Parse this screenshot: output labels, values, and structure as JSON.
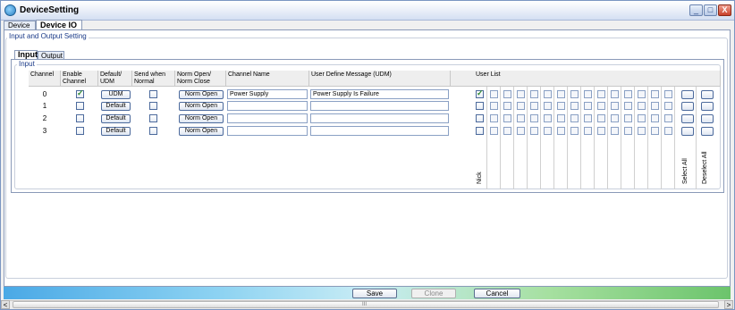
{
  "window": {
    "title": "DeviceSetting",
    "minimize": "_",
    "maximize": "□",
    "close": "X"
  },
  "outer_tabs": [
    {
      "label": "Device Info"
    },
    {
      "label": "Device IO"
    }
  ],
  "group_title": "Input and Output Setting",
  "inner_tabs": [
    {
      "label": "Input"
    },
    {
      "label": "Output"
    }
  ],
  "input_group_title": "Input",
  "columns": {
    "channel": "Channel",
    "enable": "Enable Channel",
    "default_udm": "Default/ UDM",
    "send_normal": "Send when Normal",
    "norm_mode": "Norm Open/ Norm Close",
    "channel_name": "Channel Name",
    "udm": "User Define Message (UDM)",
    "user_list": "User List"
  },
  "rows": [
    {
      "channel": "0",
      "enabled": true,
      "mode_btn": "UDM",
      "send_normal": false,
      "norm_btn": "Norm Open",
      "name": "Power Supply",
      "udm": "Power Supply Is Failure",
      "user_first": true
    },
    {
      "channel": "1",
      "enabled": false,
      "mode_btn": "Default",
      "send_normal": false,
      "norm_btn": "Norm Open",
      "name": "",
      "udm": "",
      "user_first": false
    },
    {
      "channel": "2",
      "enabled": false,
      "mode_btn": "Default",
      "send_normal": false,
      "norm_btn": "Norm Open",
      "name": "",
      "udm": "",
      "user_first": false
    },
    {
      "channel": "3",
      "enabled": false,
      "mode_btn": "Default",
      "send_normal": false,
      "norm_btn": "Norm Open",
      "name": "",
      "udm": "",
      "user_first": false
    }
  ],
  "user_list": {
    "first_user": "Nick",
    "select_all": "Select All",
    "deselect_all": "Deselect All",
    "extra_columns": 14
  },
  "buttons": {
    "save": "Save",
    "clone": "Clone",
    "cancel": "Cancel"
  },
  "scrollbar": {
    "left_arrow": "<",
    "right_arrow": ">",
    "grip": "III"
  }
}
